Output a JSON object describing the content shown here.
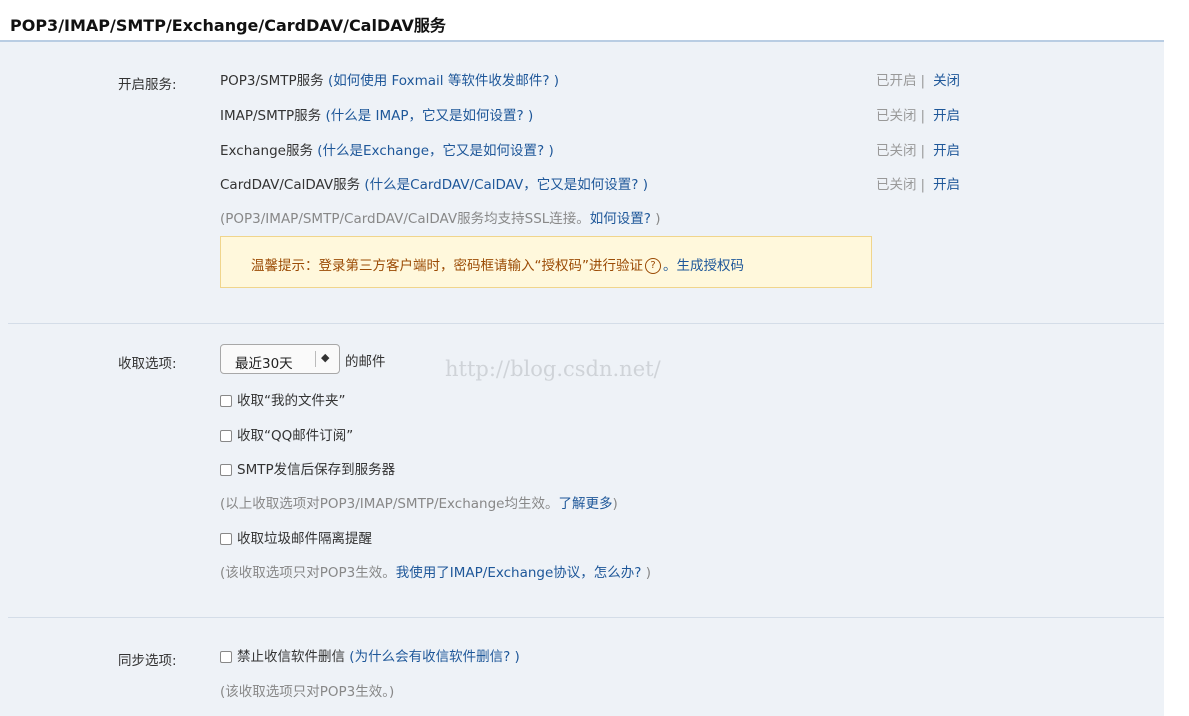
{
  "header": {
    "title": "POP3/IMAP/SMTP/Exchange/CardDAV/CalDAV服务"
  },
  "services": {
    "label": "开启服务:",
    "items": [
      {
        "name": "POP3/SMTP服务",
        "help": "(如何使用 Foxmail 等软件收发邮件? )",
        "status": "已开启",
        "action": "关闭"
      },
      {
        "name": "IMAP/SMTP服务",
        "help": "(什么是 IMAP，它又是如何设置? )",
        "status": "已关闭",
        "action": "开启"
      },
      {
        "name": "Exchange服务",
        "help": "(什么是Exchange，它又是如何设置? )",
        "status": "已关闭",
        "action": "开启"
      },
      {
        "name": "CardDAV/CalDAV服务",
        "help": "(什么是CardDAV/CalDAV，它又是如何设置? )",
        "status": "已关闭",
        "action": "开启"
      }
    ],
    "ssl_note_prefix": "(POP3/IMAP/SMTP/CardDAV/CalDAV服务均支持SSL连接。",
    "ssl_note_link": "如何设置?",
    "ssl_note_suffix": " )",
    "separator": "|"
  },
  "tip": {
    "text": "温馨提示：登录第三方客户端时，密码框请输入“授权码”进行验证",
    "icon": "?",
    "link": "。生成授权码"
  },
  "receive": {
    "label": "收取选项:",
    "range_value": "最近30天",
    "range_arrow": "◆",
    "range_suffix": "的邮件",
    "options": [
      "收取“我的文件夹”",
      "收取“QQ邮件订阅”",
      "SMTP发信后保存到服务器"
    ],
    "note1_prefix": "(以上收取选项对POP3/IMAP/SMTP/Exchange均生效。",
    "note1_link": "了解更多",
    "note1_suffix": ")",
    "spam_option": "收取垃圾邮件隔离提醒",
    "note2_prefix": "(该收取选项只对POP3生效。",
    "note2_link": "我使用了IMAP/Exchange协议，怎么办?",
    "note2_suffix": " )"
  },
  "watermark": "http://blog.csdn.net/",
  "sync": {
    "label": "同步选项:",
    "option": "禁止收信软件删信",
    "option_help": "(为什么会有收信软件删信? )",
    "note": "(该收取选项只对POP3生效。)"
  }
}
